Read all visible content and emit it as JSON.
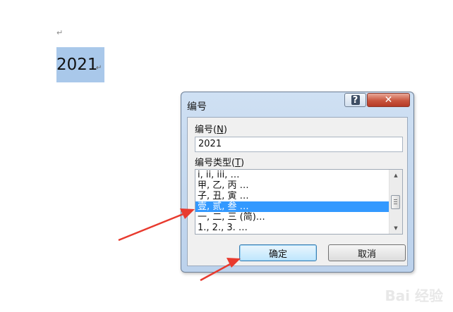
{
  "document": {
    "paragraph_mark": "↵",
    "selected_number": "2021",
    "number_paragraph_mark": "↵"
  },
  "dialog": {
    "title": "编号",
    "help_label": "?",
    "close_label": "✕",
    "number_label": "编号(",
    "number_hotkey": "N",
    "number_label_end": ")",
    "number_value": "2021",
    "type_label": "编号类型(",
    "type_hotkey": "T",
    "type_label_end": ")",
    "types": [
      "i, ii, iii, …",
      "甲, 乙, 丙 …",
      "子, 丑, 寅 …",
      "壹, 贰, 叁 …",
      "一, 二, 三 (简)…",
      "1., 2., 3. …"
    ],
    "selected_type_index": 3,
    "ok_label": "确定",
    "cancel_label": "取消"
  },
  "colors": {
    "selection_highlight": "#a9c8ea",
    "list_selection": "#3399ff",
    "annotation_arrow": "#e83a2e"
  },
  "watermark": "Bai 经验"
}
